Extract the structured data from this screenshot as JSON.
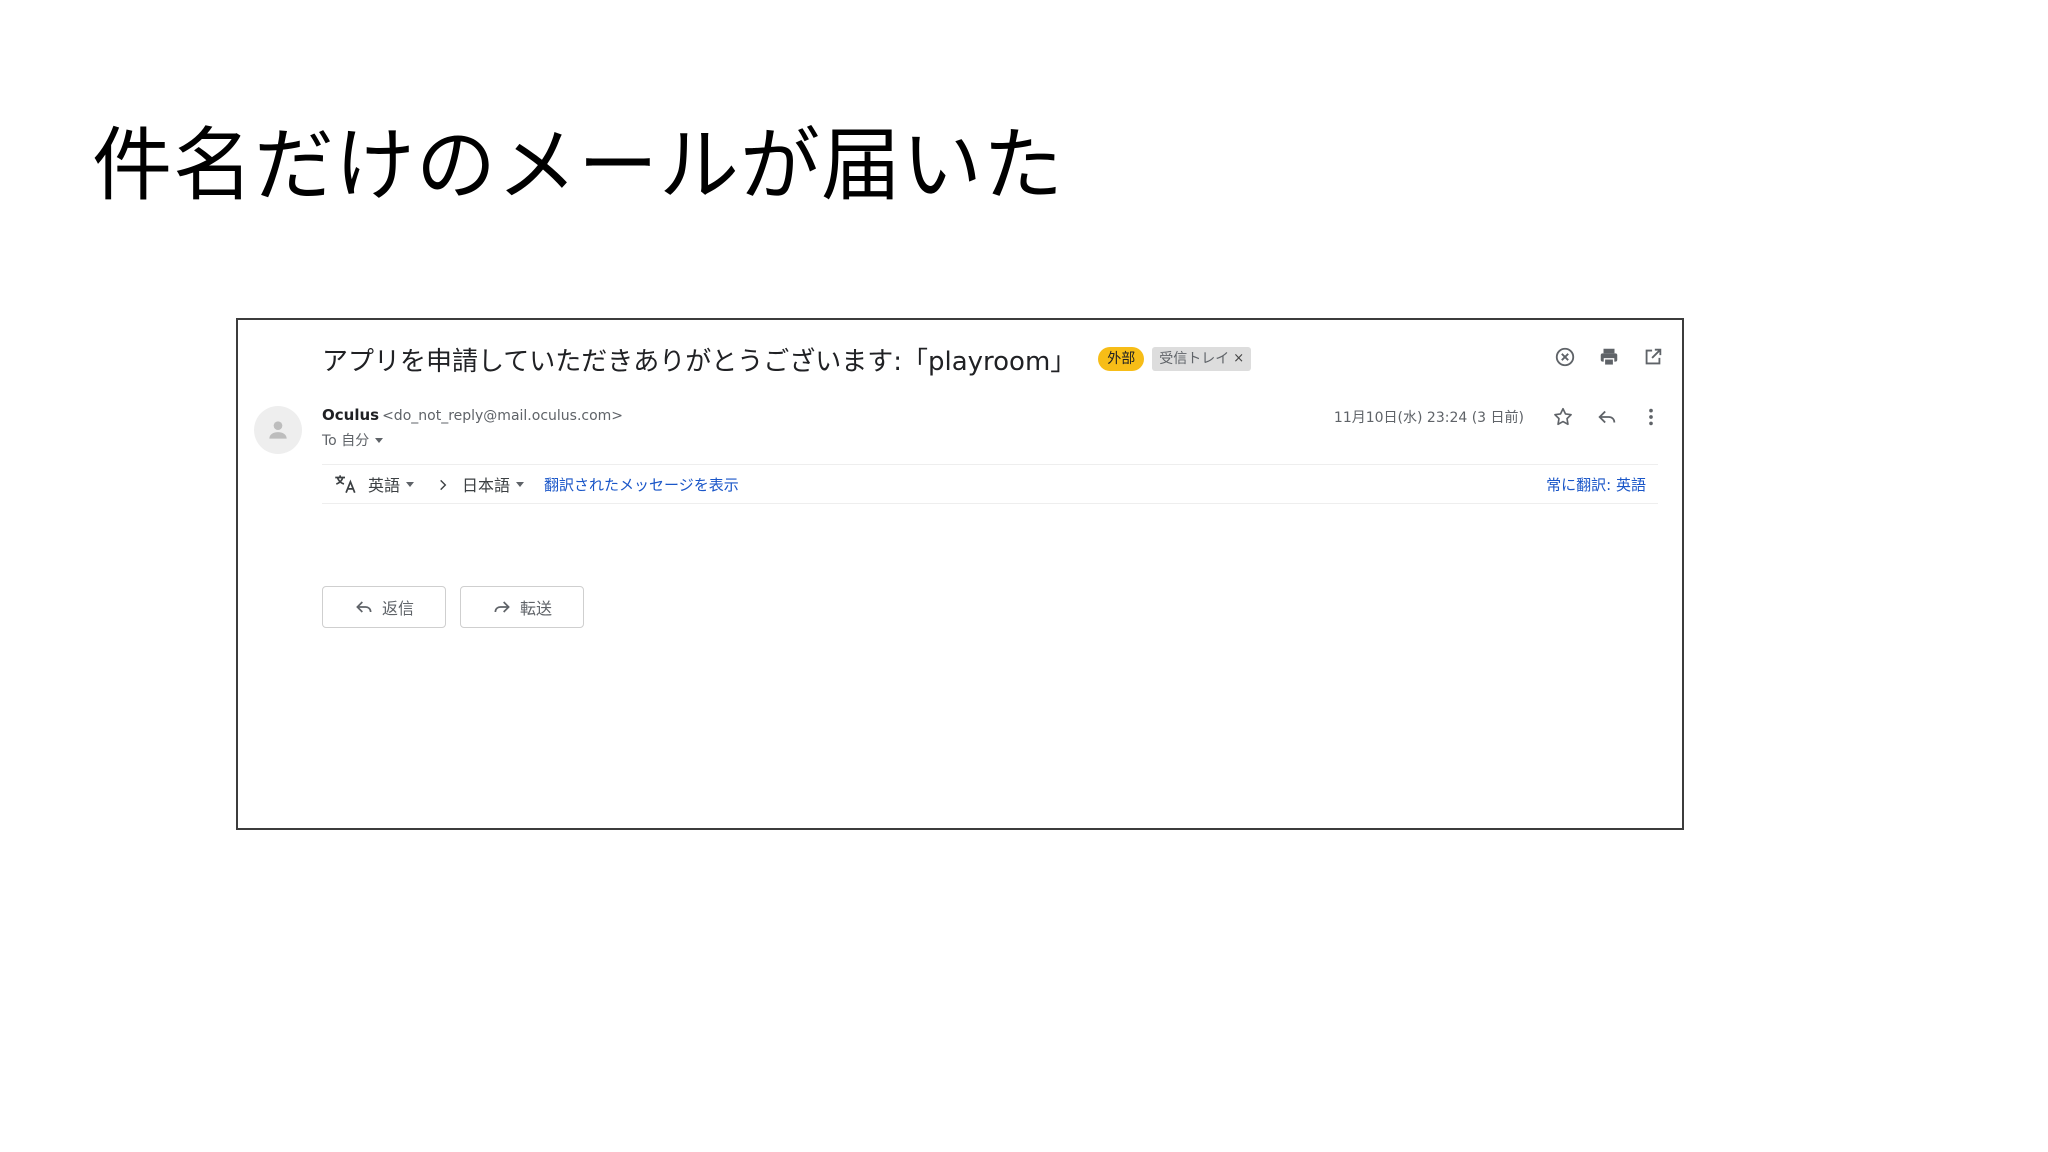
{
  "slide": {
    "title": "件名だけのメールが届いた"
  },
  "email": {
    "subject": "アプリを申請していただきありがとうございます:「playroom」",
    "labels": {
      "external": "外部",
      "inbox": "受信トレイ",
      "inbox_close": "×"
    },
    "top_icons": [
      "close-circle-icon",
      "print-icon",
      "open-in-new-icon"
    ],
    "sender": {
      "name": "Oculus",
      "email": "<do_not_reply@mail.oculus.com>",
      "to": "To 自分"
    },
    "date": "11月10日(水) 23:24 (3 日前)",
    "meta_icons": [
      "star-icon",
      "reply-icon",
      "more-vert-icon"
    ],
    "translate_bar": {
      "source_lang": "英語",
      "target_lang": "日本語",
      "show_translated": "翻訳されたメッセージを表示",
      "always_translate": "常に翻訳: 英語"
    },
    "actions": {
      "reply": "返信",
      "forward": "転送"
    }
  },
  "colors": {
    "external_label": "#f7bd17",
    "inbox_label": "#dddddd",
    "link": "#1a56c8",
    "frame_border": "#3c3c3c"
  }
}
